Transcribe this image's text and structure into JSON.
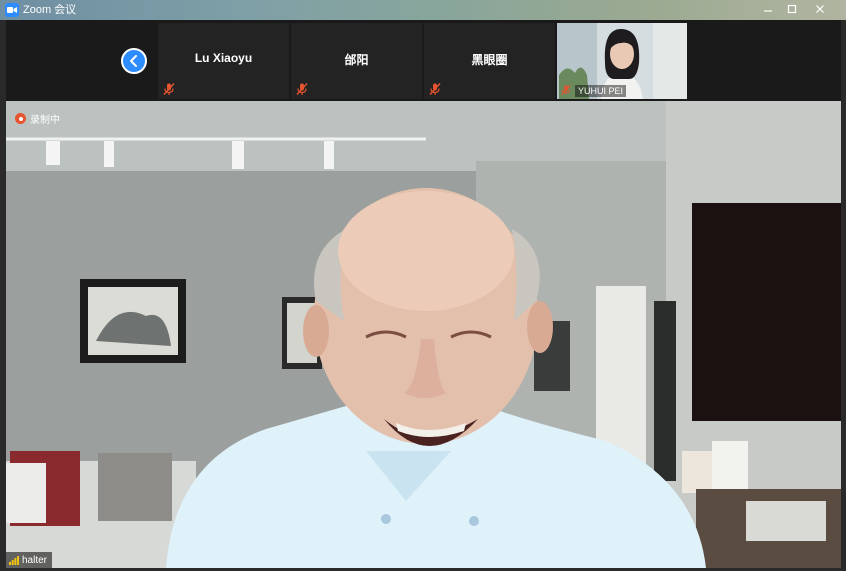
{
  "window": {
    "title": "Zoom 会议",
    "controls": [
      "minimize-icon",
      "maximize-icon",
      "close-icon"
    ]
  },
  "gallery": {
    "nav_icon": "chevron-left-icon",
    "participants": [
      {
        "name": "Lu Xiaoyu",
        "muted": true
      },
      {
        "name": "邰阳",
        "muted": true
      },
      {
        "name": "黑眼圈",
        "muted": true
      },
      {
        "name": "YUHUI PEI",
        "muted": true,
        "video": true
      }
    ]
  },
  "main": {
    "recording_label": "录制中",
    "speaker_name": "halter"
  },
  "colors": {
    "accent": "#2d8cff",
    "muted": "#e8542f",
    "recording": "#e8542f"
  }
}
